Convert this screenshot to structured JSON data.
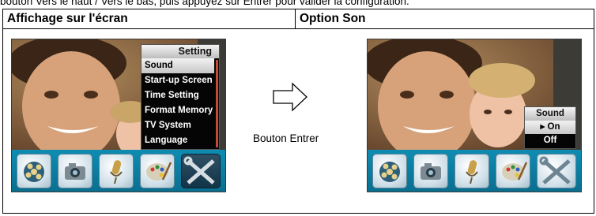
{
  "intro_text": "bouton Vers le haut / Vers le bas, puis appuyez sur Entrer pour valider la configuration.",
  "table": {
    "header_left": "Affichage sur l'écran",
    "header_right": "Option Son"
  },
  "setting_menu": {
    "title": "Setting",
    "items": [
      "Sound",
      "Start-up Screen",
      "Time Setting",
      "Format Memory",
      "TV System",
      "Language"
    ],
    "selected_index": 0
  },
  "arrow_caption": "Bouton Entrer",
  "sound_menu": {
    "title": "Sound",
    "options": [
      "▸ On",
      "Off"
    ],
    "selected_index": 0
  },
  "icons": [
    "film-reel-icon",
    "camera-icon",
    "microphone-icon",
    "paint-palette-icon",
    "tools-icon"
  ],
  "colors": {
    "icon_bar": "#0e8cb3",
    "scrollbar": "#c24b35",
    "menu_bg": "#050505"
  }
}
